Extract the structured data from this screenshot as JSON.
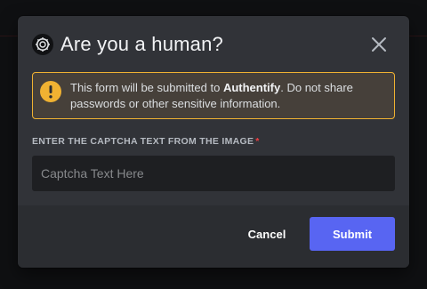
{
  "modal": {
    "title": "Are you a human?",
    "app_icon": "gear-badge-icon",
    "close_icon": "close-icon"
  },
  "warning": {
    "icon": "exclamation-circle-icon",
    "text_before": "This form will be submitted to ",
    "app_name": "Authentify",
    "text_after": ". Do not share passwords or other sensitive information."
  },
  "captcha": {
    "label": "ENTER THE CAPTCHA TEXT FROM THE IMAGE",
    "required_marker": "*",
    "placeholder": "Captcha Text Here",
    "value": ""
  },
  "footer": {
    "cancel_label": "Cancel",
    "submit_label": "Submit"
  },
  "colors": {
    "modal_background": "#313338",
    "footer_background": "#2b2d31",
    "warning_border": "#f0b232",
    "warning_background": "#46403a",
    "primary_button": "#5865f2",
    "required_red": "#f23f43"
  }
}
